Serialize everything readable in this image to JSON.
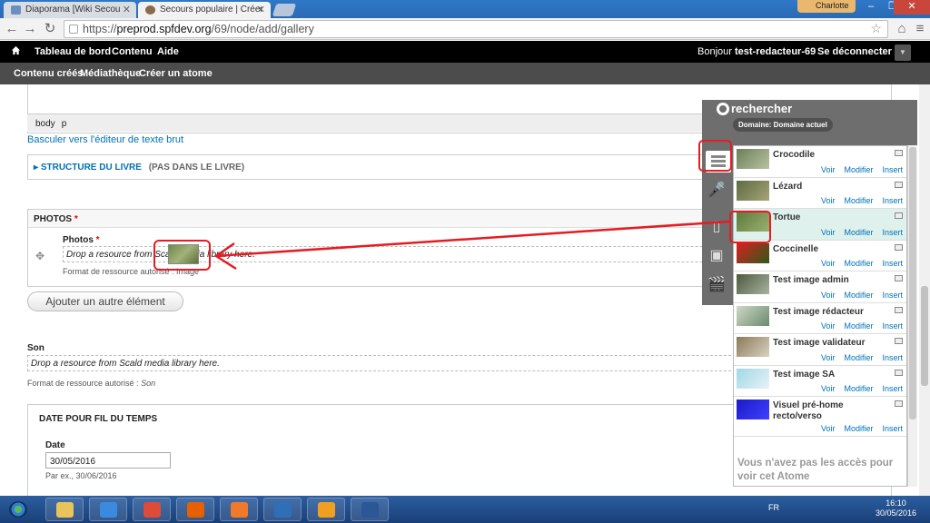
{
  "browser": {
    "tabs": [
      {
        "title": "Diaporama [Wiki Secou"
      },
      {
        "title": "Secours populaire | Créer"
      }
    ],
    "user": "Charlotte",
    "url_prefix": "https://",
    "url_host": "preprod.spfdev.org",
    "url_path": "/69/node/add/gallery"
  },
  "admin_bar": {
    "items": [
      "Tableau de bord",
      "Contenu",
      "Aide"
    ],
    "greeting_prefix": "Bonjour",
    "username": "test-redacteur-69",
    "logout": "Se déconnecter"
  },
  "shortcuts": [
    "Contenu créés",
    "Médiathèque",
    "Créer un atome"
  ],
  "editor": {
    "path": [
      "body",
      "p"
    ],
    "switch_link": "Basculer vers l'éditeur de texte brut"
  },
  "structure": {
    "title": "STRUCTURE DU LIVRE",
    "note": "(PAS DANS LE LIVRE)"
  },
  "photos": {
    "legend": "PHOTOS",
    "required_mark": "*",
    "label": "Photos",
    "drop_text": "Drop a resource from Scald media library here.",
    "format": "Format de ressource autorisé : Image"
  },
  "add_another": "Ajouter un autre élément",
  "son": {
    "label": "Son",
    "drop_text": "Drop a resource from Scald media library here.",
    "format_prefix": "Format de ressource autorisé :",
    "format_value": "Son"
  },
  "date": {
    "legend": "DATE POUR FIL DU TEMPS",
    "label": "Date",
    "value": "30/05/2016",
    "hint": "Par ex., 30/06/2016"
  },
  "scald": {
    "title": "rechercher",
    "domain": "Domaine: Domaine actuel",
    "atoms": [
      {
        "title": "Crocodile",
        "colors": [
          "#6b7f5a",
          "#b8c3a0"
        ]
      },
      {
        "title": "Lézard",
        "colors": [
          "#5d6b3e",
          "#a6a37a"
        ]
      },
      {
        "title": "Tortue",
        "colors": [
          "#5d7a3e",
          "#9bb070"
        ]
      },
      {
        "title": "Coccinelle",
        "colors": [
          "#d92020",
          "#2e5a1a"
        ]
      },
      {
        "title": "Test image admin",
        "colors": [
          "#4d5a3e",
          "#a9b3a0"
        ]
      },
      {
        "title": "Test image rédacteur",
        "colors": [
          "#cfd8c8",
          "#6b8a6b"
        ]
      },
      {
        "title": "Test image validateur",
        "colors": [
          "#8a7a5a",
          "#d9d2c0"
        ]
      },
      {
        "title": "Test image SA",
        "colors": [
          "#9fd8e8",
          "#e8f2f4"
        ]
      },
      {
        "title": "Visuel pré-home recto/verso",
        "colors": [
          "#1a1ac8",
          "#4040ff"
        ]
      }
    ],
    "actions": {
      "view": "Voir",
      "edit": "Modifier",
      "insert": "Insert"
    },
    "no_access": "Vous n'avez pas les accès pour voir cet Atome"
  },
  "taskbar": {
    "lang": "FR",
    "time": "16:10",
    "date": "30/05/2016",
    "apps": [
      {
        "name": "explorer",
        "color": "#e8c45a"
      },
      {
        "name": "internet-explorer",
        "color": "#3a8be0"
      },
      {
        "name": "chrome",
        "color": "#dd4b39"
      },
      {
        "name": "firefox",
        "color": "#e66000"
      },
      {
        "name": "media-player",
        "color": "#f07a2a"
      },
      {
        "name": "outlook-calendar",
        "color": "#2f6fb8"
      },
      {
        "name": "outlook",
        "color": "#f0a020"
      },
      {
        "name": "word",
        "color": "#2b5797"
      }
    ]
  },
  "colors": {
    "accent_link": "#0071b3",
    "annotation_red": "#e51c23",
    "selected_row": "#dff1ec"
  }
}
